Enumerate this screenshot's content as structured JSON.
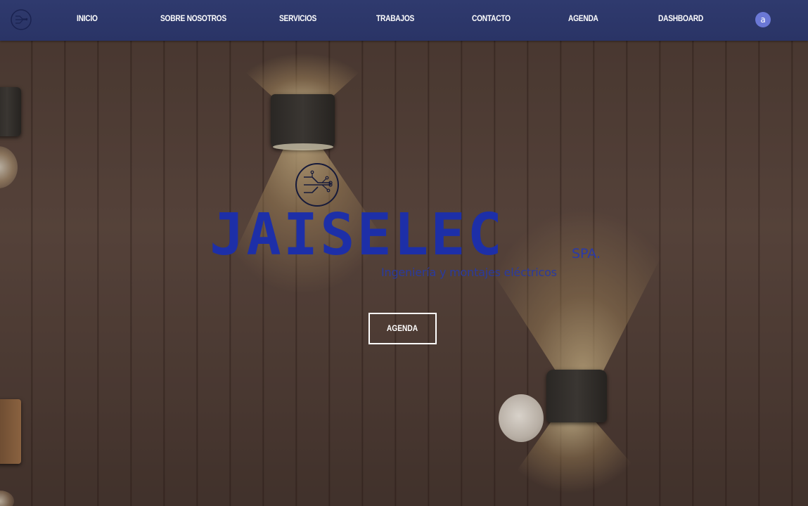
{
  "nav": {
    "logo_icon": "jaiselec-circuit-logo-icon",
    "items": [
      {
        "label": "INICIO"
      },
      {
        "label": "SOBRE NOSOTROS"
      },
      {
        "label": "SERVICIOS"
      },
      {
        "label": "TRABAJOS"
      },
      {
        "label": "CONTACTO"
      },
      {
        "label": "AGENDA"
      },
      {
        "label": "DASHBOARD"
      }
    ],
    "avatar_initial": "a"
  },
  "hero": {
    "background": "wall-lamps-on-wood-panel-photo",
    "emblem_icon": "circuit-emblem-icon",
    "brand_name": "JAISELEC",
    "brand_suffix": "SPA.",
    "tagline": "Ingeniería y montajes eléctricos",
    "cta_label": "AGENDA"
  },
  "colors": {
    "navbar": "#2f3a6e",
    "brand_blue": "#1d2fa8",
    "avatar": "#6b78d6",
    "nav_text": "#ffffff"
  }
}
